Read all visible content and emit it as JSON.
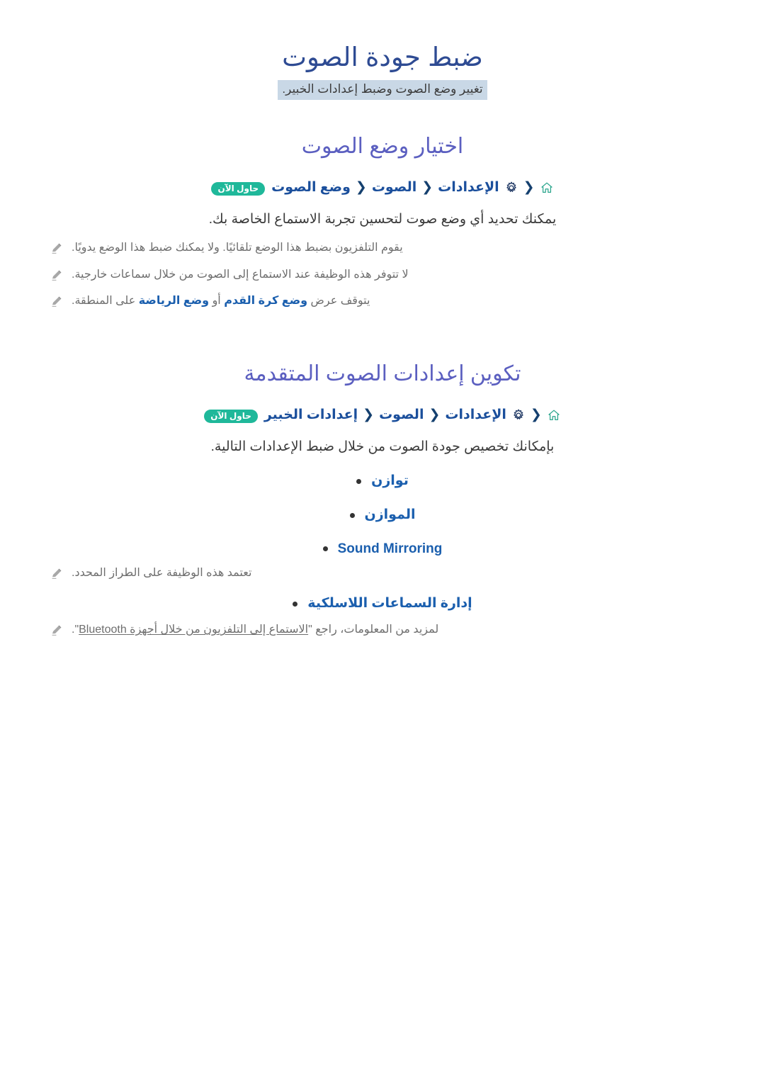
{
  "header": {
    "title": "ضبط جودة الصوت",
    "subtitle": "تغيير وضع الصوت وضبط إعدادات الخبير."
  },
  "icons": {
    "home": "home-icon",
    "gear": "gear-icon",
    "chevron": "❮",
    "pencil": "pencil-icon"
  },
  "colors": {
    "title_blue": "#2e4b93",
    "section_purple": "#5b5fc0",
    "path_blue": "#1b4f9c",
    "badge_teal": "#1fb89a",
    "home_icon_teal": "#2aa58c",
    "subtitle_highlight": "#c9d8e6",
    "note_gray": "#6e6e6e",
    "emphasis_blue": "#1b5fae"
  },
  "sections": [
    {
      "id": "sound-mode",
      "title": "اختيار وضع الصوت",
      "path": {
        "items": [
          "الإعدادات",
          "الصوت",
          "وضع الصوت"
        ],
        "badge": "حاول الآن"
      },
      "body": "يمكنك تحديد أي وضع صوت لتحسين تجربة الاستماع الخاصة بك.",
      "notes": [
        {
          "pre": "يقوم التلفزيون بضبط هذا الوضع تلقائيًا. ولا يمكنك ضبط هذا الوضع يدويًا.",
          "em1": "",
          "mid": "",
          "em2": "",
          "post": ""
        },
        {
          "pre": "لا تتوفر هذه الوظيفة عند الاستماع إلى الصوت من خلال سماعات خارجية.",
          "em1": "",
          "mid": "",
          "em2": "",
          "post": ""
        },
        {
          "pre": "يتوقف عرض ",
          "em1": "وضع كرة القدم",
          "mid": " أو ",
          "em2": "وضع الرياضة",
          "post": " على المنطقة."
        }
      ]
    },
    {
      "id": "advanced-sound",
      "title": "تكوين إعدادات الصوت المتقدمة",
      "path": {
        "items": [
          "الإعدادات",
          "الصوت",
          "إعدادات الخبير"
        ],
        "badge": "حاول الآن"
      },
      "body": "بإمكانك تخصيص جودة الصوت من خلال ضبط الإعدادات التالية.",
      "bullets": [
        {
          "label": "توازن",
          "latin": false
        },
        {
          "label": "الموازن",
          "latin": false
        },
        {
          "label": "Sound Mirroring",
          "latin": true
        },
        {
          "label": "إدارة السماعات اللاسلكية",
          "latin": false
        }
      ],
      "bullet_notes": {
        "sound_mirroring": "تعتمد هذه الوظيفة على الطراز المحدد.",
        "wireless": {
          "pre": "لمزيد من المعلومات، راجع \"",
          "link": "الاستماع إلى التلفزيون من خلال أجهزة Bluetooth",
          "post": "\"."
        }
      }
    }
  ]
}
